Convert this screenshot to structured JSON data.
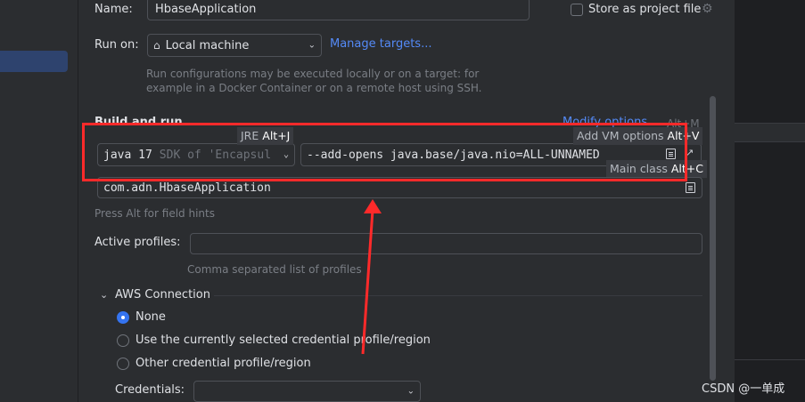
{
  "name_label": "Name:",
  "name_value": "HbaseApplication",
  "store_label": "Store as project file",
  "run_on_label": "Run on:",
  "run_on_value": "Local machine",
  "manage_targets": "Manage targets...",
  "run_hint_1": "Run configurations may be executed locally or on a target: for",
  "run_hint_2": "example in a Docker Container or on a remote host using SSH.",
  "build_run_label": "Build and run",
  "modify_options": "Modify options",
  "modify_shortcut": "Alt+M",
  "jre_tip": "JRE",
  "jre_tip_key": "Alt+J",
  "sdk_version": "java 17",
  "sdk_desc": "SDK of 'Encapsul",
  "vm_options_value": "--add-opens java.base/java.nio=ALL-UNNAMED",
  "vm_tip": "Add VM options",
  "vm_tip_key": "Alt+V",
  "main_class_tip": "Main class",
  "main_class_tip_key": "Alt+C",
  "main_class_value": "com.adn.HbaseApplication",
  "field_hints": "Press Alt for field hints",
  "active_profiles_label": "Active profiles:",
  "active_profiles_value": "",
  "profiles_hint": "Comma separated list of profiles",
  "aws_section": "AWS Connection",
  "aws_options": [
    {
      "label": "None",
      "selected": true
    },
    {
      "label": "Use the currently selected credential profile/region",
      "selected": false
    },
    {
      "label": "Other credential profile/region",
      "selected": false
    }
  ],
  "credentials_label": "Credentials:",
  "credentials_value": "",
  "watermark": "CSDN @一单成",
  "colors": {
    "accent": "#3574f0",
    "link": "#548af7",
    "highlight": "#ff2a2a"
  }
}
